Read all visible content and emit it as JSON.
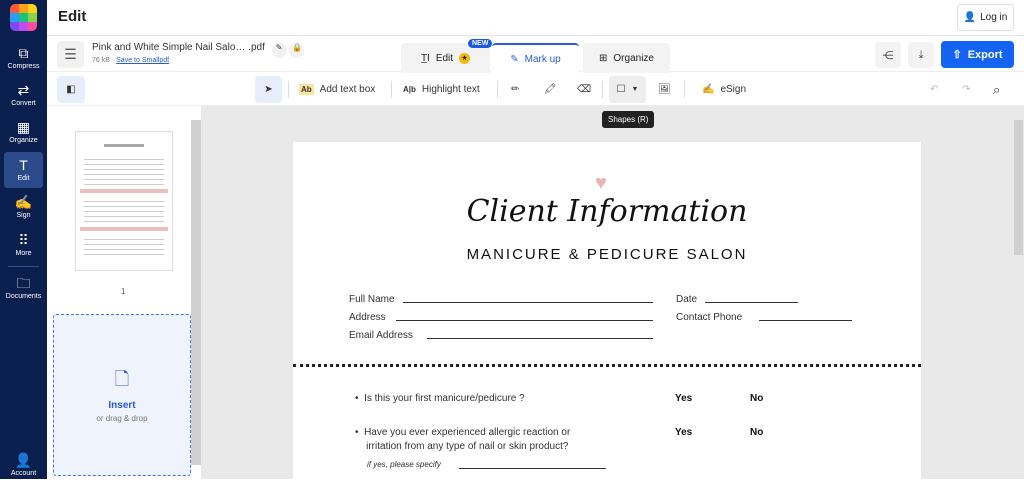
{
  "app": {
    "title": "Edit",
    "login": "Log in"
  },
  "sidebar": {
    "items": [
      {
        "label": "Compress",
        "icon": "compress-icon"
      },
      {
        "label": "Convert",
        "icon": "convert-icon"
      },
      {
        "label": "Organize",
        "icon": "organize-icon"
      },
      {
        "label": "Edit",
        "icon": "edit-icon"
      },
      {
        "label": "Sign",
        "icon": "sign-icon"
      },
      {
        "label": "More",
        "icon": "more-icon"
      },
      {
        "label": "Documents",
        "icon": "documents-icon"
      },
      {
        "label": "Account",
        "icon": "account-icon"
      }
    ]
  },
  "file": {
    "name": "Pink and White Simple Nail Salo… .pdf",
    "size": "76 kB",
    "save_link": "Save to Smallpdf"
  },
  "tabs": [
    {
      "label": "Edit"
    },
    {
      "label": "Mark up"
    },
    {
      "label": "Organize"
    }
  ],
  "new_badge": "NEW",
  "export": "Export",
  "toolbar": {
    "add_text_box": "Add text box",
    "highlight_text": "Highlight text",
    "esign": "eSign",
    "tooltip": "Shapes (R)"
  },
  "thumbs": {
    "page_number": "1",
    "insert": "Insert",
    "insert_sub": "or drag & drop"
  },
  "document": {
    "title_script": "Client Information",
    "subtitle": "MANICURE & PEDICURE SALON",
    "fields": {
      "full_name": "Full Name",
      "address": "Address",
      "email": "Email Address",
      "date": "Date",
      "phone": "Contact Phone"
    },
    "questions": [
      {
        "text": "Is this your first manicure/pedicure ?",
        "yes": "Yes",
        "no": "No"
      },
      {
        "text": "Have you ever experienced allergic reaction or",
        "text2": "irritation from any type of nail or skin product?",
        "yes": "Yes",
        "no": "No",
        "specify": "if yes, please specify"
      }
    ]
  },
  "colors": {
    "sidebar": "#0a1f4e",
    "accent": "#1463f3",
    "heart": "#e8b4b4"
  }
}
